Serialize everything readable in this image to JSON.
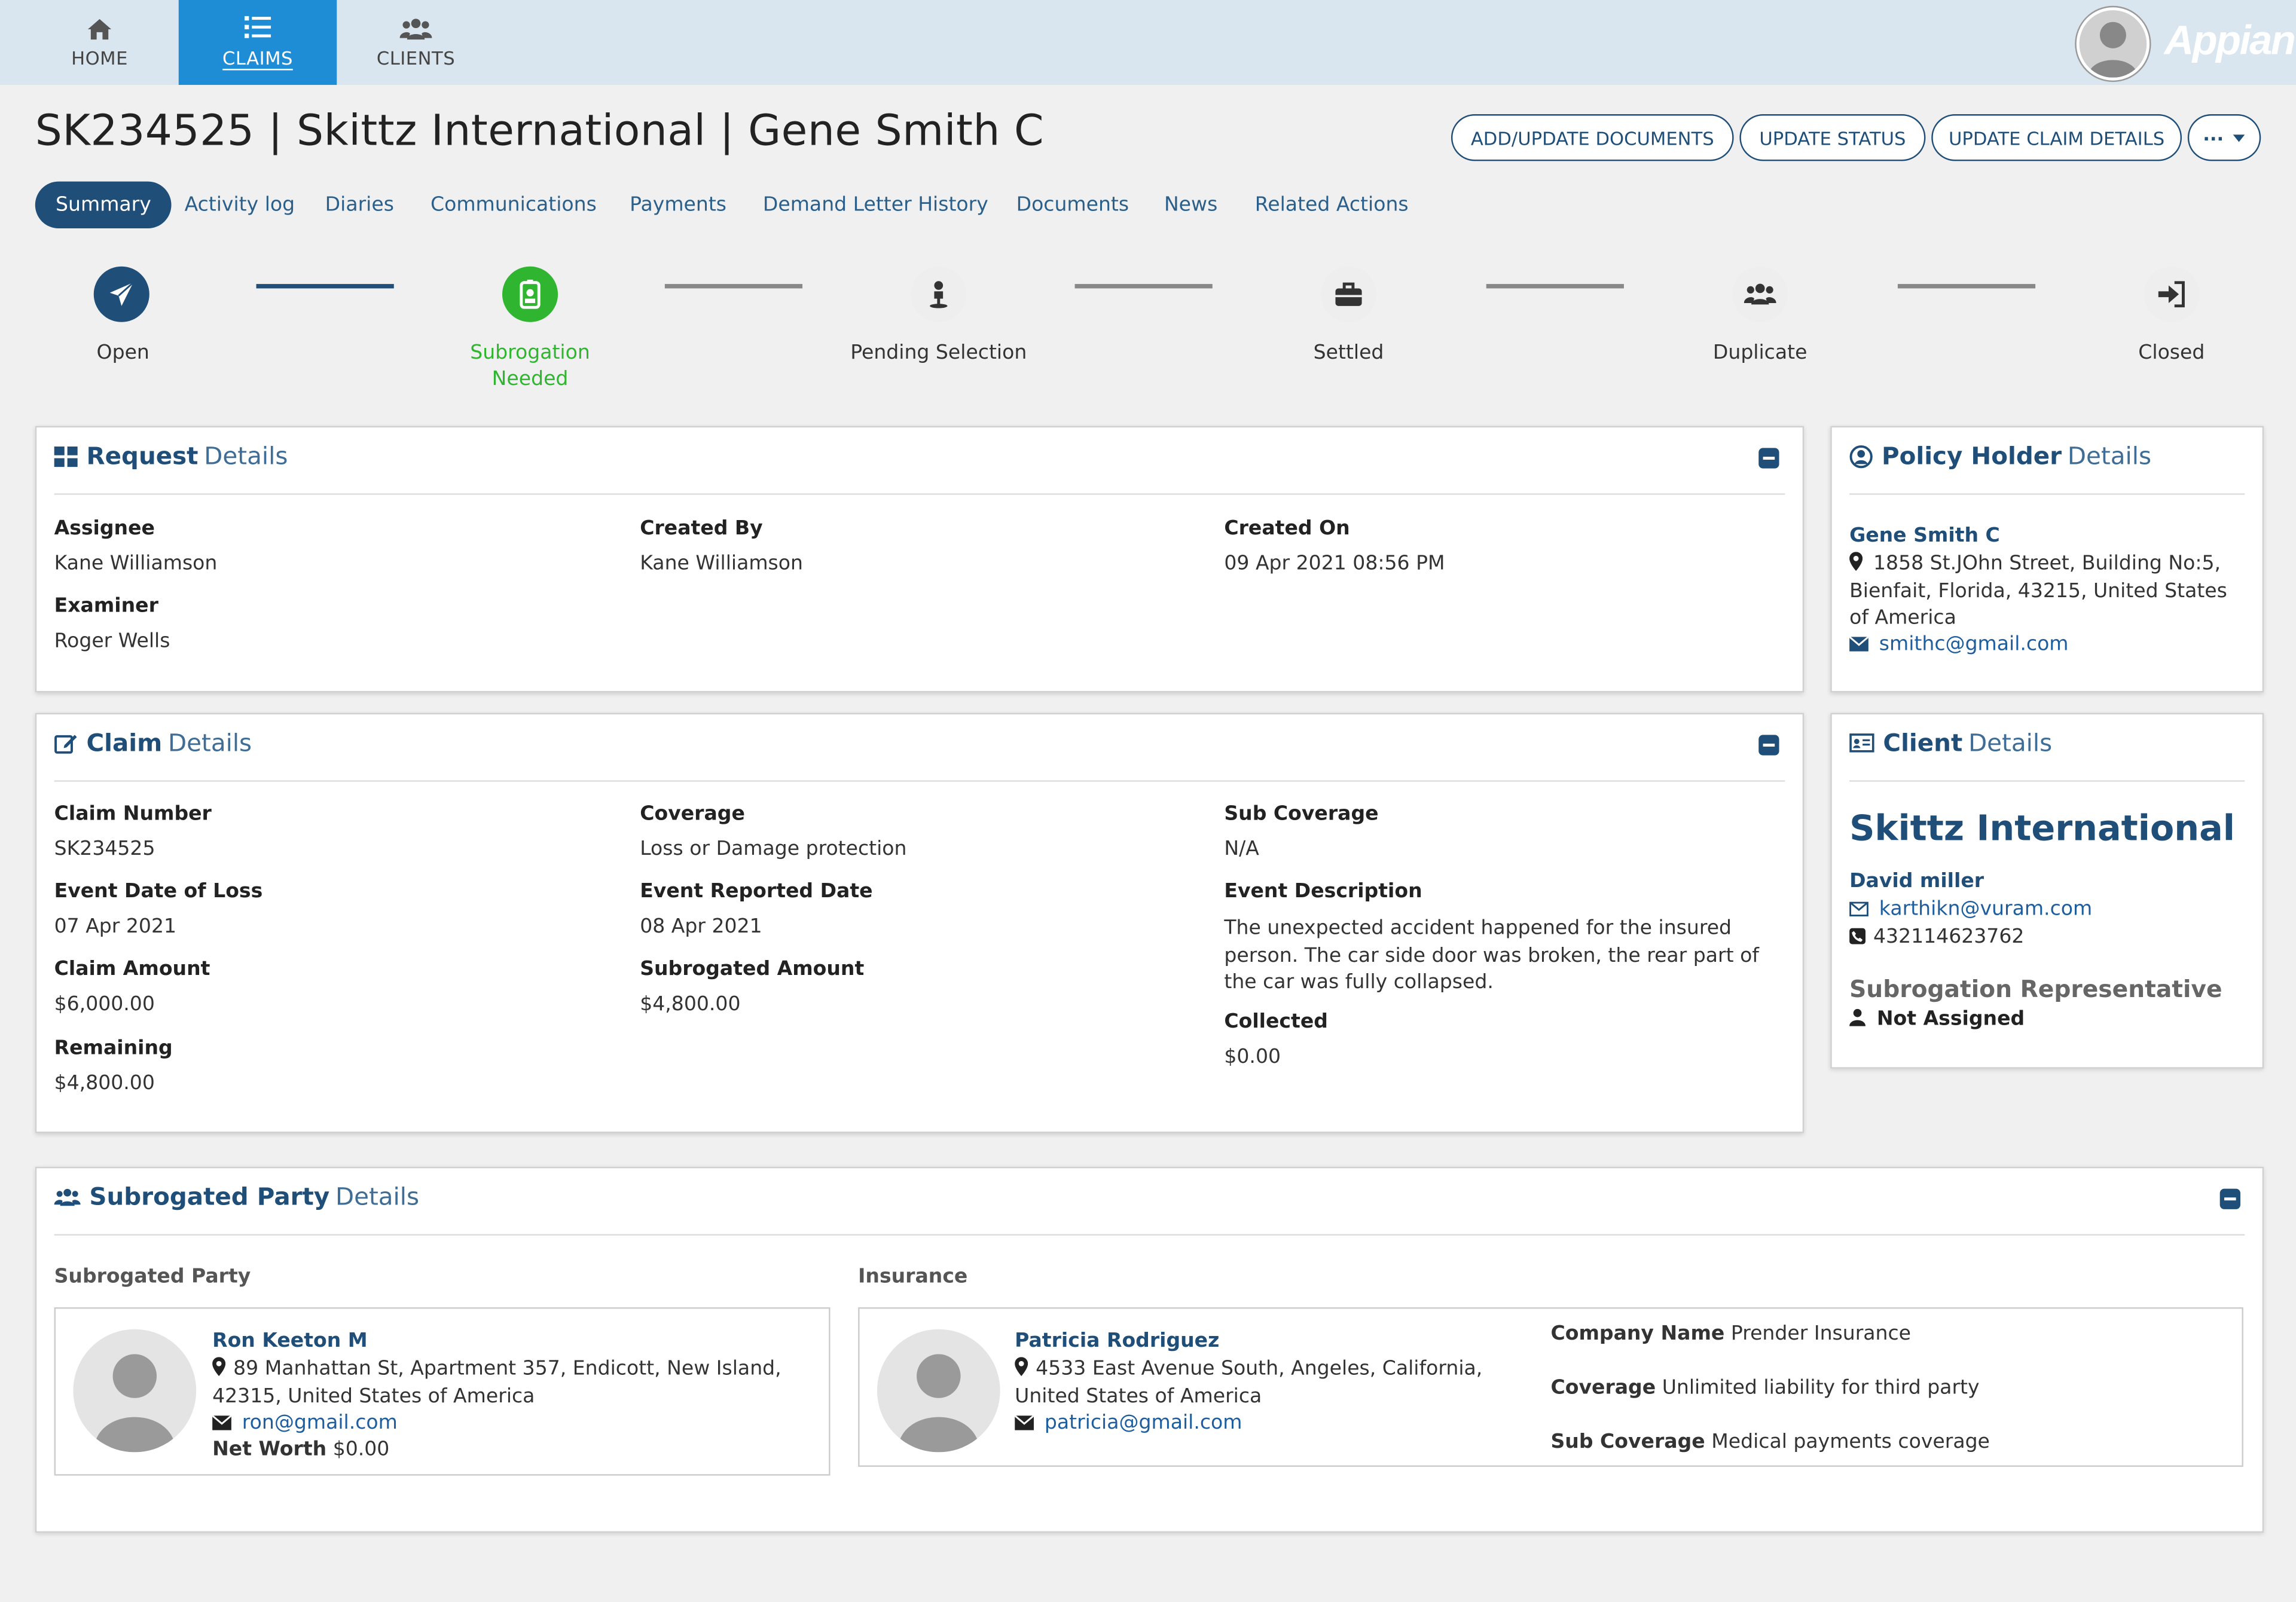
{
  "nav": {
    "items": [
      {
        "label": "HOME",
        "icon": "home-icon"
      },
      {
        "label": "CLAIMS",
        "icon": "list-icon"
      },
      {
        "label": "CLIENTS",
        "icon": "users-icon"
      }
    ],
    "brand": "Appian"
  },
  "header": {
    "title": "SK234525 | Skittz International | Gene Smith C",
    "buttons": {
      "add_docs": "ADD/UPDATE DOCUMENTS",
      "update_status": "UPDATE STATUS",
      "update_claim": "UPDATE CLAIM DETAILS",
      "more": "···"
    }
  },
  "tabs": [
    "Summary",
    "Activity log",
    "Diaries",
    "Communications",
    "Payments",
    "Demand Letter History",
    "Documents",
    "News",
    "Related Actions"
  ],
  "progress": {
    "steps": [
      {
        "label": "Open"
      },
      {
        "label_1": "Subrogation",
        "label_2": "Needed"
      },
      {
        "label": "Pending Selection"
      },
      {
        "label": "Settled"
      },
      {
        "label": "Duplicate"
      },
      {
        "label": "Closed"
      }
    ],
    "colors": {
      "done": "#1f4e79",
      "current": "#2fb52f",
      "pending": "#eeeeee"
    }
  },
  "request": {
    "title_bold": "Request",
    "title_light": "Details",
    "assignee_label": "Assignee",
    "assignee": "Kane Williamson",
    "examiner_label": "Examiner",
    "examiner": "Roger Wells",
    "created_by_label": "Created By",
    "created_by": "Kane Williamson",
    "created_on_label": "Created On",
    "created_on": "09 Apr 2021 08:56 PM"
  },
  "claim": {
    "title_bold": "Claim",
    "title_light": "Details",
    "claim_number_label": "Claim Number",
    "claim_number": "SK234525",
    "event_date_label": "Event Date of Loss",
    "event_date": "07 Apr 2021",
    "claim_amount_label": "Claim Amount",
    "claim_amount": "$6,000.00",
    "remaining_label": "Remaining",
    "remaining": "$4,800.00",
    "coverage_label": "Coverage",
    "coverage": "Loss or Damage protection",
    "reported_label": "Event Reported Date",
    "reported": "08 Apr 2021",
    "subrogated_label": "Subrogated Amount",
    "subrogated": "$4,800.00",
    "sub_coverage_label": "Sub Coverage",
    "sub_coverage": "N/A",
    "description_label": "Event Description",
    "description": "The unexpected accident happened for the insured person. The car side door was broken, the rear part of the car was fully collapsed.",
    "collected_label": "Collected",
    "collected": "$0.00"
  },
  "policy_holder": {
    "title_bold": "Policy Holder",
    "title_light": "Details",
    "name": "Gene Smith C",
    "address": "1858 St.JOhn Street, Building No:5, Bienfait, Florida, 43215, United States of America",
    "email": "smithc@gmail.com"
  },
  "client": {
    "title_bold": "Client",
    "title_light": "Details",
    "company": "Skittz International",
    "contact": "David miller",
    "email": "karthikn@vuram.com",
    "phone": "432114623762",
    "rep_label": "Subrogation Representative",
    "rep_value": "Not Assigned"
  },
  "subrogated_party": {
    "title_bold": "Subrogated Party",
    "title_light": "Details",
    "party_heading": "Subrogated Party",
    "insurance_heading": "Insurance",
    "party": {
      "name": "Ron Keeton M",
      "address": "89 Manhattan St, Apartment 357, Endicott, New Island, 42315, United States of America",
      "email": "ron@gmail.com",
      "net_worth_label": "Net Worth",
      "net_worth": "$0.00"
    },
    "insurance": {
      "name": "Patricia Rodriguez",
      "address": "4533 East Avenue South, Angeles, California, United States of America",
      "email": "patricia@gmail.com",
      "company_label": "Company Name",
      "company": "Prender Insurance",
      "coverage_label": "Coverage",
      "coverage": "Unlimited liability for third party",
      "sub_coverage_label": "Sub Coverage",
      "sub_coverage": "Medical payments coverage"
    }
  }
}
